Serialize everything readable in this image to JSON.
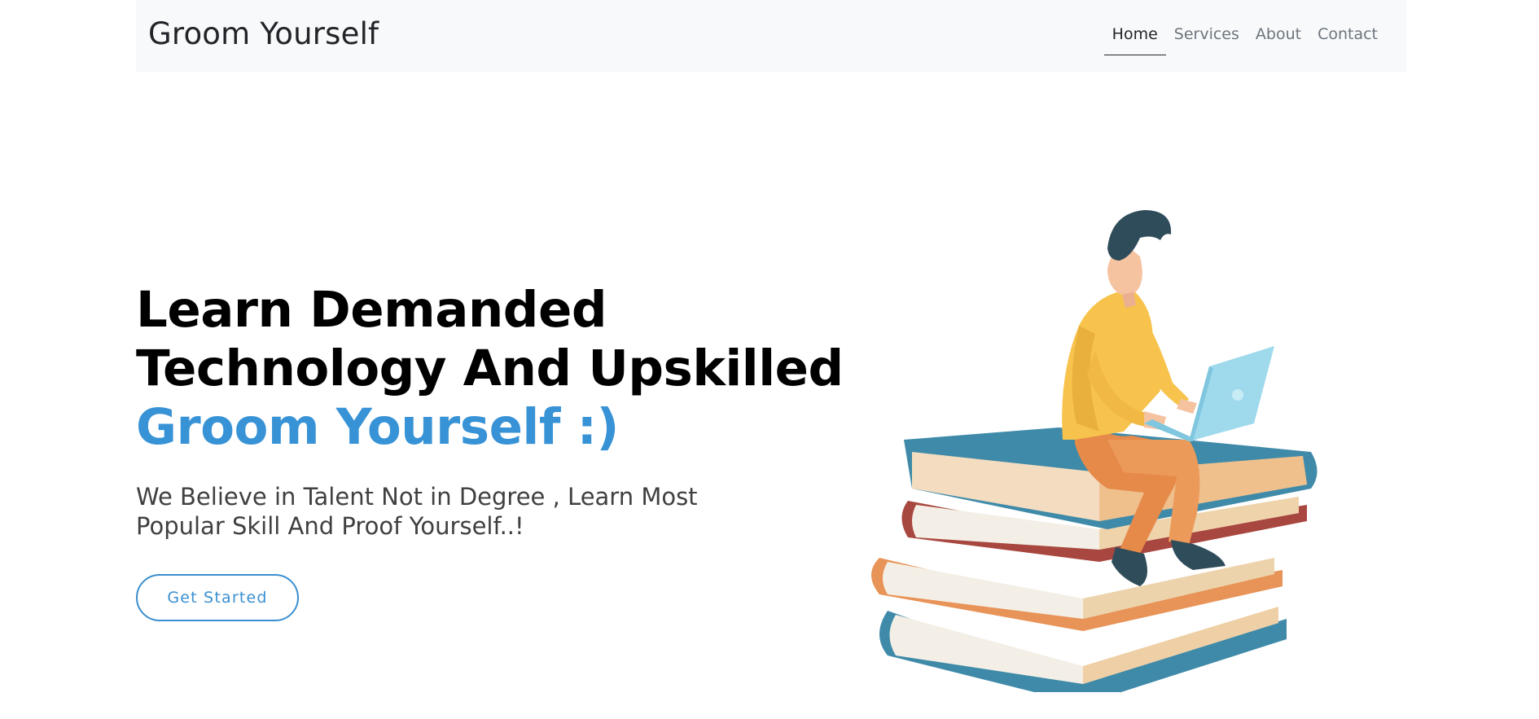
{
  "navbar": {
    "brand": "Groom Yourself",
    "links": [
      {
        "label": "Home",
        "active": true
      },
      {
        "label": "Services",
        "active": false
      },
      {
        "label": "About",
        "active": false
      },
      {
        "label": "Contact",
        "active": false
      }
    ]
  },
  "hero": {
    "title_line1": "Learn Demanded",
    "title_line2": "Technology And Upskilled",
    "title_accent": "Groom Yourself :)",
    "subtitle": "We Believe in Talent Not in Degree , Learn Most Popular Skill And Proof Yourself..!",
    "cta_label": "Get Started",
    "illustration": "man-reading-on-books-illustration"
  },
  "colors": {
    "accent": "#3893d6",
    "navbar_bg": "#f8f9fa",
    "text_dark": "#000000",
    "text_muted": "#6c757d"
  }
}
